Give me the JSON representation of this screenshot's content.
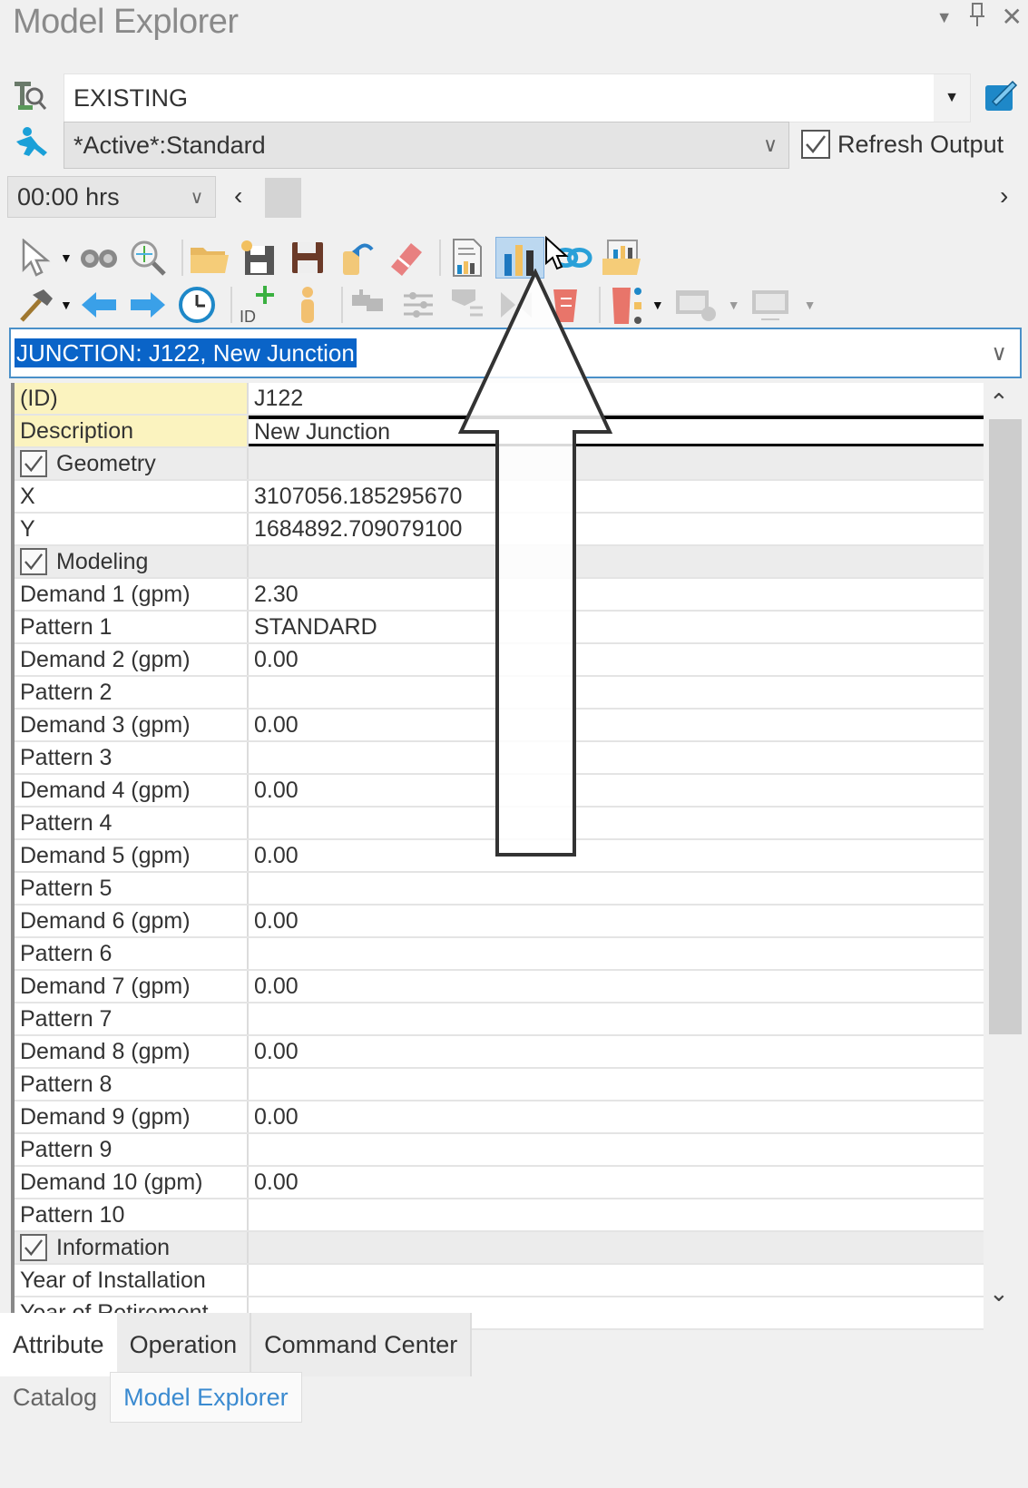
{
  "window": {
    "title": "Model Explorer",
    "controls": [
      "dropdown-icon",
      "pin-icon",
      "close-icon"
    ]
  },
  "scenario": {
    "value": "EXISTING",
    "icon": "scenario-query-icon",
    "action_icon": "scenario-manager-icon"
  },
  "alternative": {
    "value": "*Active*:Standard",
    "icon": "run-icon",
    "refresh_output": {
      "label": "Refresh Output",
      "checked": true
    }
  },
  "time": {
    "value": "00:00 hrs"
  },
  "toolbar_row1": [
    {
      "name": "select-pointer-icon",
      "dropdown": true
    },
    {
      "name": "binoculars-icon"
    },
    {
      "name": "zoom-to-icon"
    },
    {
      "name": "open-folder-icon"
    },
    {
      "name": "save-as-icon"
    },
    {
      "name": "save-icon"
    },
    {
      "name": "undo-icon"
    },
    {
      "name": "eraser-icon"
    },
    {
      "name": "report-icon"
    },
    {
      "name": "graph-icon",
      "hovered": true
    },
    {
      "name": "link-icon"
    },
    {
      "name": "folder-chart-icon"
    }
  ],
  "toolbar_row2": [
    {
      "name": "hammer-icon",
      "dropdown": true
    },
    {
      "name": "back-arrow-icon"
    },
    {
      "name": "forward-arrow-icon"
    },
    {
      "name": "history-icon"
    },
    {
      "name": "add-id-icon"
    },
    {
      "name": "person-icon"
    },
    {
      "name": "hydrant-icon",
      "disabled": true
    },
    {
      "name": "settings-sliders-icon",
      "disabled": true
    },
    {
      "name": "network-icon",
      "disabled": true
    },
    {
      "name": "valve-icon",
      "disabled": true
    },
    {
      "name": "tank-icon"
    },
    {
      "name": "tank-level-icon",
      "dropdown": true
    },
    {
      "name": "table-view-icon",
      "dropdown": true,
      "disabled": true
    },
    {
      "name": "monitor-icon",
      "dropdown": true,
      "disabled": true
    }
  ],
  "element_selector": {
    "value": "JUNCTION: J122, New Junction"
  },
  "properties": [
    {
      "type": "row",
      "key": "(ID)",
      "value": "J122",
      "highlight": true
    },
    {
      "type": "row",
      "key": "Description",
      "value": "New Junction",
      "highlight": true,
      "editing": true
    },
    {
      "type": "category",
      "key": "Geometry",
      "checked": true
    },
    {
      "type": "row",
      "key": "X",
      "value": "3107056.185295670"
    },
    {
      "type": "row",
      "key": "Y",
      "value": "1684892.709079100"
    },
    {
      "type": "category",
      "key": "Modeling",
      "checked": true
    },
    {
      "type": "row",
      "key": "Demand 1 (gpm)",
      "value": "2.30"
    },
    {
      "type": "row",
      "key": "Pattern 1",
      "value": "STANDARD"
    },
    {
      "type": "row",
      "key": "Demand 2 (gpm)",
      "value": "0.00"
    },
    {
      "type": "row",
      "key": "Pattern 2",
      "value": ""
    },
    {
      "type": "row",
      "key": "Demand 3 (gpm)",
      "value": "0.00"
    },
    {
      "type": "row",
      "key": "Pattern 3",
      "value": ""
    },
    {
      "type": "row",
      "key": "Demand 4 (gpm)",
      "value": "0.00"
    },
    {
      "type": "row",
      "key": "Pattern 4",
      "value": ""
    },
    {
      "type": "row",
      "key": "Demand 5 (gpm)",
      "value": "0.00"
    },
    {
      "type": "row",
      "key": "Pattern 5",
      "value": ""
    },
    {
      "type": "row",
      "key": "Demand 6 (gpm)",
      "value": "0.00"
    },
    {
      "type": "row",
      "key": "Pattern 6",
      "value": ""
    },
    {
      "type": "row",
      "key": "Demand 7 (gpm)",
      "value": "0.00"
    },
    {
      "type": "row",
      "key": "Pattern 7",
      "value": ""
    },
    {
      "type": "row",
      "key": "Demand 8 (gpm)",
      "value": "0.00"
    },
    {
      "type": "row",
      "key": "Pattern 8",
      "value": ""
    },
    {
      "type": "row",
      "key": "Demand 9 (gpm)",
      "value": "0.00"
    },
    {
      "type": "row",
      "key": "Pattern 9",
      "value": ""
    },
    {
      "type": "row",
      "key": "Demand 10 (gpm)",
      "value": "0.00"
    },
    {
      "type": "row",
      "key": "Pattern 10",
      "value": ""
    },
    {
      "type": "category",
      "key": "Information",
      "checked": true
    },
    {
      "type": "row",
      "key": "Year of Installation",
      "value": ""
    },
    {
      "type": "row",
      "key": "Year of Retirement",
      "value": ""
    }
  ],
  "inner_tabs": [
    {
      "label": "Attribute",
      "active": true
    },
    {
      "label": "Operation",
      "active": false
    },
    {
      "label": "Command Center",
      "active": false
    }
  ],
  "outer_tabs": [
    {
      "label": "Catalog",
      "active": false
    },
    {
      "label": "Model Explorer",
      "active": true
    }
  ],
  "colors": {
    "accent": "#0a64c8",
    "highlight_key": "#fbf3bf",
    "active_tab_text": "#3a8ad0"
  }
}
